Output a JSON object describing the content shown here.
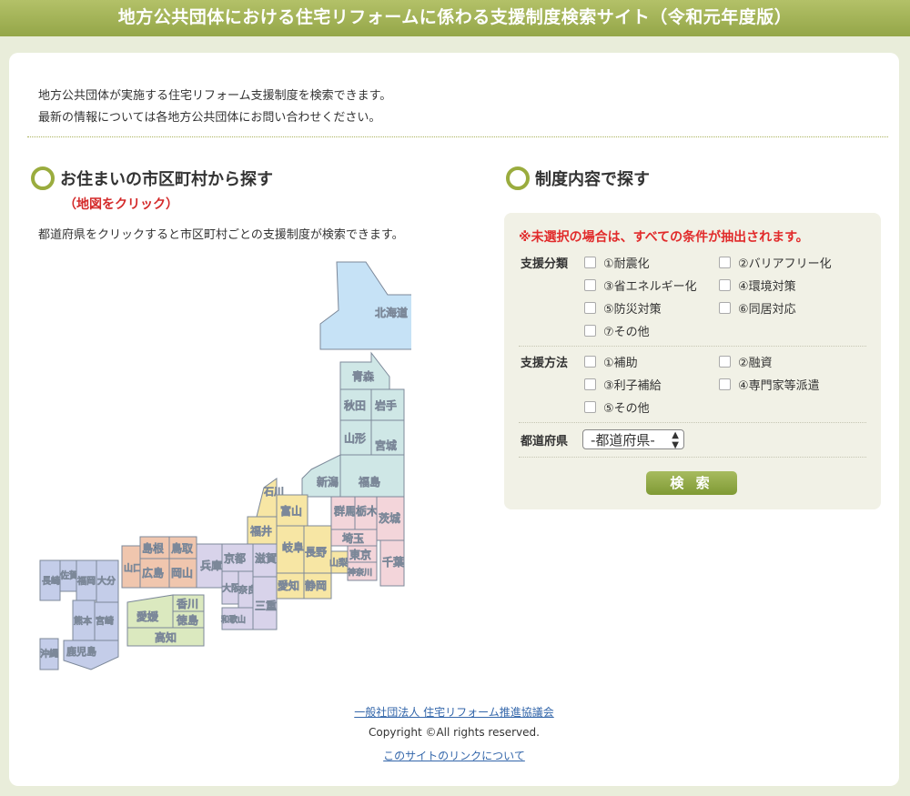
{
  "header": {
    "title": "地方公共団体における住宅リフォームに係わる支援制度検索サイト（令和元年度版）"
  },
  "intro": {
    "line1": "地方公共団体が実施する住宅リフォーム支援制度を検索できます。",
    "line2": "最新の情報については各地方公共団体にお問い合わせください。"
  },
  "map_section": {
    "title": "お住まいの市区町村から探す",
    "note": "（地図をクリック）",
    "description": "都道府県をクリックすると市区町村ごとの支援制度が検索できます。"
  },
  "prefectures": {
    "hokkaido": "北海道",
    "aomori": "青森",
    "akita": "秋田",
    "iwate": "岩手",
    "yamagata": "山形",
    "miyagi": "宮城",
    "niigata": "新潟",
    "fukushima": "福島",
    "ishikawa": "石川",
    "toyama": "富山",
    "gunma": "群馬",
    "tochigi": "栃木",
    "ibaraki": "茨城",
    "fukui": "福井",
    "gifu": "岐阜",
    "nagano": "長野",
    "saitama": "埼玉",
    "shimane": "島根",
    "tottori": "鳥取",
    "hyogo": "兵庫",
    "kyoto": "京都",
    "shiga": "滋賀",
    "yamanashi": "山梨",
    "tokyo": "東京",
    "chiba": "千葉",
    "yamaguchi": "山口",
    "hiroshima": "広島",
    "okayama": "岡山",
    "osaka": "大阪",
    "nara": "奈良",
    "mie": "三重",
    "aichi": "愛知",
    "shizuoka": "静岡",
    "kanagawa": "神奈川",
    "wakayama": "和歌山",
    "nagasaki": "長崎",
    "saga": "佐賀",
    "fukuoka": "福岡",
    "oita": "大分",
    "kumamoto": "熊本",
    "miyazaki": "宮崎",
    "kagoshima": "鹿児島",
    "okinawa": "沖縄",
    "kagawa": "香川",
    "ehime": "愛媛",
    "tokushima": "徳島",
    "kochi": "高知"
  },
  "colors": {
    "hokkaido": "#c6e2f6",
    "tohoku": "#cfe7e6",
    "kanto": "#f3d5da",
    "chubu": "#f7e6a4",
    "kinki": "#d8d3ea",
    "chugoku": "#f0c6ae",
    "shikoku": "#dbe9bf",
    "kyushu": "#c4cde9",
    "accent": "#9aac3e"
  },
  "search_section": {
    "title": "制度内容で探す",
    "warning": "※未選択の場合は、すべての条件が抽出されます。",
    "category_label": "支援分類",
    "categories": [
      "①耐震化",
      "②バリアフリー化",
      "③省エネルギー化",
      "④環境対策",
      "⑤防災対策",
      "⑥同居対応",
      "⑦その他"
    ],
    "method_label": "支援方法",
    "methods": [
      "①補助",
      "②融資",
      "③利子補給",
      "④専門家等派遣",
      "⑤その他"
    ],
    "prefecture_label": "都道府県",
    "prefecture_select": "-都道府県-",
    "search_button": "検 索"
  },
  "footer": {
    "org_link": "一般社団法人 住宅リフォーム推進協議会",
    "copyright": "Copyright ©All rights reserved.",
    "site_link": "このサイトのリンクについて"
  }
}
